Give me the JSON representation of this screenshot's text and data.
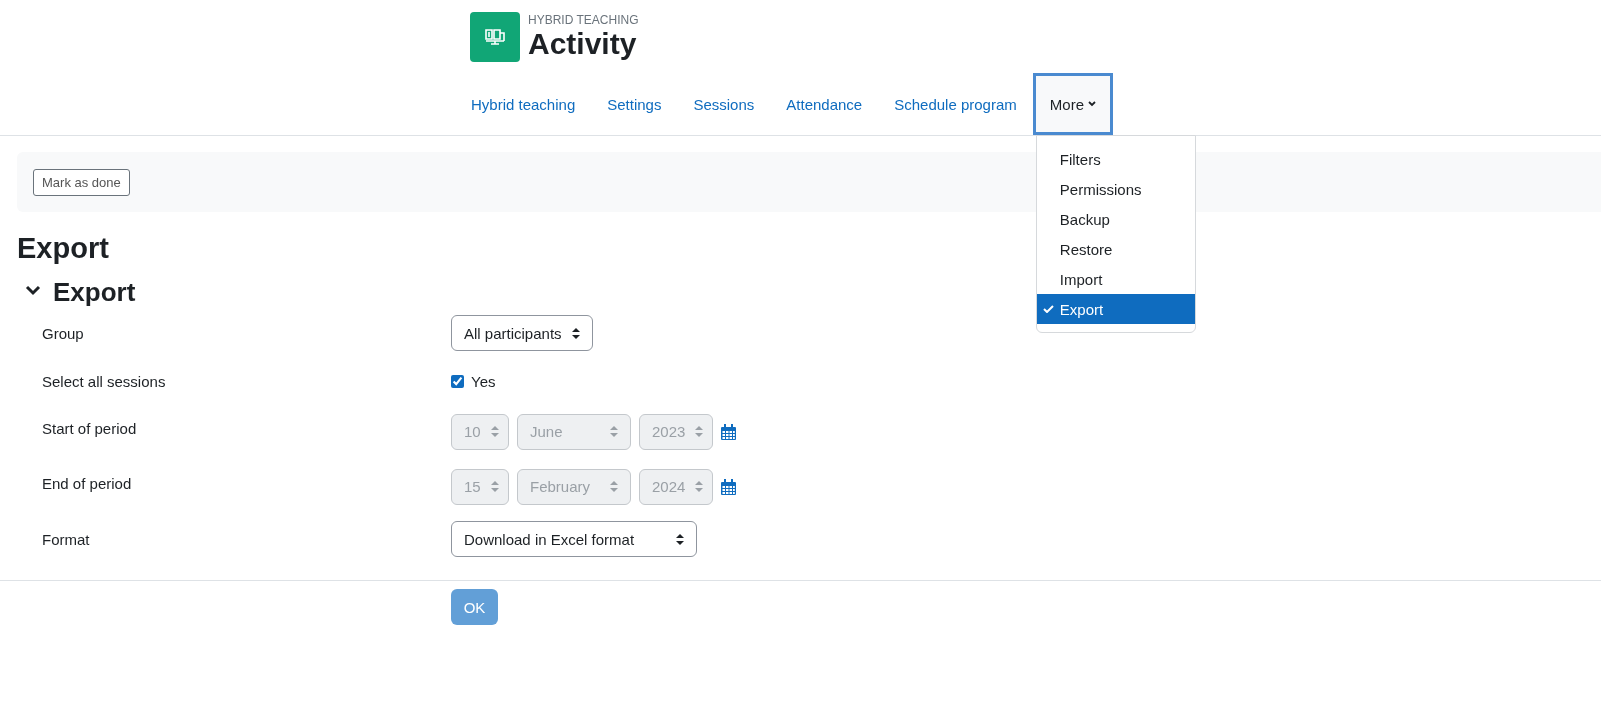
{
  "header": {
    "subtitle": "HYBRID TEACHING",
    "title": "Activity"
  },
  "nav": {
    "tabs": [
      {
        "label": "Hybrid teaching"
      },
      {
        "label": "Settings"
      },
      {
        "label": "Sessions"
      },
      {
        "label": "Attendance"
      },
      {
        "label": "Schedule program"
      }
    ],
    "more": {
      "label": "More",
      "expanded": true,
      "items": [
        {
          "label": "Filters",
          "selected": false
        },
        {
          "label": "Permissions",
          "selected": false
        },
        {
          "label": "Backup",
          "selected": false
        },
        {
          "label": "Restore",
          "selected": false
        },
        {
          "label": "Import",
          "selected": false
        },
        {
          "label": "Export",
          "selected": true
        }
      ]
    }
  },
  "completion": {
    "button": "Mark as done"
  },
  "page_title": "Export",
  "section": {
    "title": "Export",
    "expanded": true
  },
  "fields": [
    {
      "kind": "select",
      "label": "Group",
      "value": "All participants"
    },
    {
      "kind": "checkbox",
      "label": "Select all sessions",
      "checked": true,
      "option": "Yes"
    },
    {
      "kind": "date",
      "label": "Start of period",
      "disabled": true,
      "day": "10",
      "month": "June",
      "year": "2023"
    },
    {
      "kind": "date",
      "label": "End of period",
      "disabled": true,
      "day": "15",
      "month": "February",
      "year": "2024"
    },
    {
      "kind": "select",
      "label": "Format",
      "value": "Download in Excel format"
    }
  ],
  "submit": {
    "label": "OK",
    "disabled": true
  }
}
